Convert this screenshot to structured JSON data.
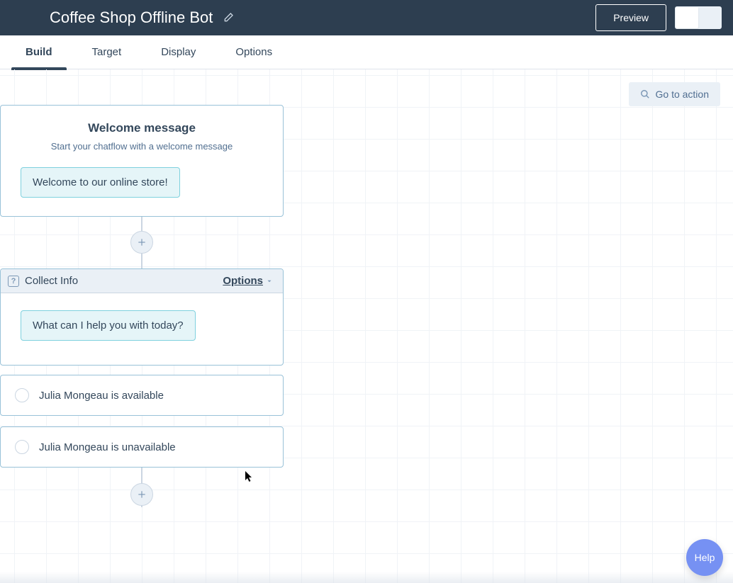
{
  "header": {
    "title": "Coffee Shop Offline Bot",
    "preview_label": "Preview"
  },
  "tabs": [
    {
      "label": "Build",
      "active": true
    },
    {
      "label": "Target",
      "active": false
    },
    {
      "label": "Display",
      "active": false
    },
    {
      "label": "Options",
      "active": false
    }
  ],
  "canvas": {
    "goto_action_label": "Go to action",
    "welcome": {
      "title": "Welcome message",
      "subtitle": "Start your chatflow with a welcome message",
      "bubble": "Welcome to our online store!"
    },
    "collect": {
      "header_label": "Collect Info",
      "options_label": "Options",
      "bubble": "What can I help you with today?"
    },
    "branches": [
      {
        "label": "Julia Mongeau is available"
      },
      {
        "label": "Julia Mongeau is unavailable"
      }
    ]
  },
  "help_label": "Help"
}
